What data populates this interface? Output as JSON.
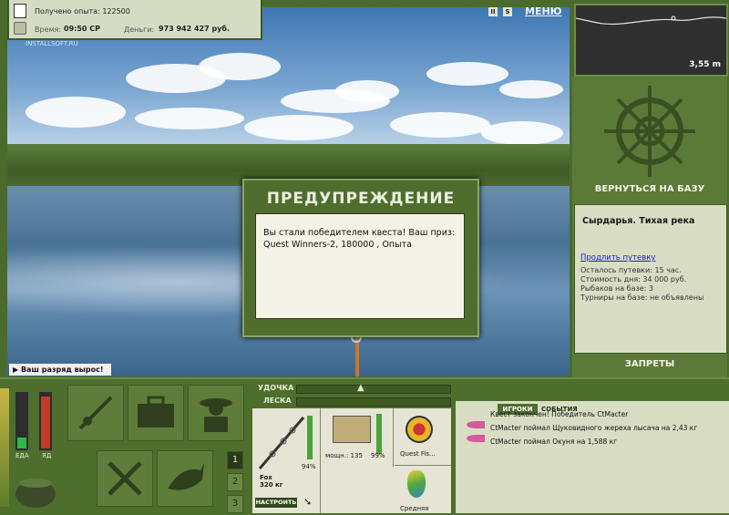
{
  "info": {
    "xp_gained": "Получено опыта: 122500",
    "time_label": "Время:",
    "time_value": "09:50 СР",
    "money_label": "Деньги:",
    "money_value": "973 942 427 руб.",
    "watermark": "INSTALLSOFT.RU"
  },
  "topbar": {
    "pause": "II",
    "sound": "S",
    "menu": "МЕНЮ"
  },
  "minimap": {
    "depth": "3,55 m"
  },
  "right": {
    "return_base": "ВЕРНУТЬСЯ НА БАЗУ",
    "location": "Сырдарья. Тихая река",
    "extend_link": "Продлить путевку",
    "remaining": "Осталось путевки: 15 час.",
    "day_cost": "Стоимость дня: 34 000 руб.",
    "fishers": "Рыбаков на базе: 3",
    "tournaments": "Турниры на базе: не объявлены",
    "bans": "ЗАПРЕТЫ"
  },
  "dialog": {
    "title": "ПРЕДУПРЕЖДЕНИЕ",
    "message": "Вы стали победителем квеста! Ваш приз: Quest Winners-2, 180000 , Опыта"
  },
  "notice": "Ваш разряд вырос!",
  "meters": {
    "food": "ЕДА",
    "poison": "ЯД",
    "food_level": 0.2,
    "poison_level": 0.95
  },
  "pages": [
    "1",
    "2",
    "3"
  ],
  "tackle": {
    "rod_label": "УДОЧКА",
    "line_label": "ЛЕСКА",
    "rod_name": "Fox",
    "rod_weight": "320 кг",
    "rod_pct": "94%",
    "reel_power": "мощн.: 135",
    "reel_pct": "99%",
    "line_name": "Quest Fis...",
    "lure_name": "Средняя",
    "setup_button": "НАСТРОИТЬ"
  },
  "events": {
    "tab_players": "ИГРОКИ",
    "tab_events": "СОБЫТИЯ",
    "rows": [
      "Квест закончен! Победитель CtMacter",
      "CtMacter поймал Щуковидного жереха лысача на 2,43 кг",
      "CtMacter поймал Окуня на 1,588 кг"
    ]
  }
}
